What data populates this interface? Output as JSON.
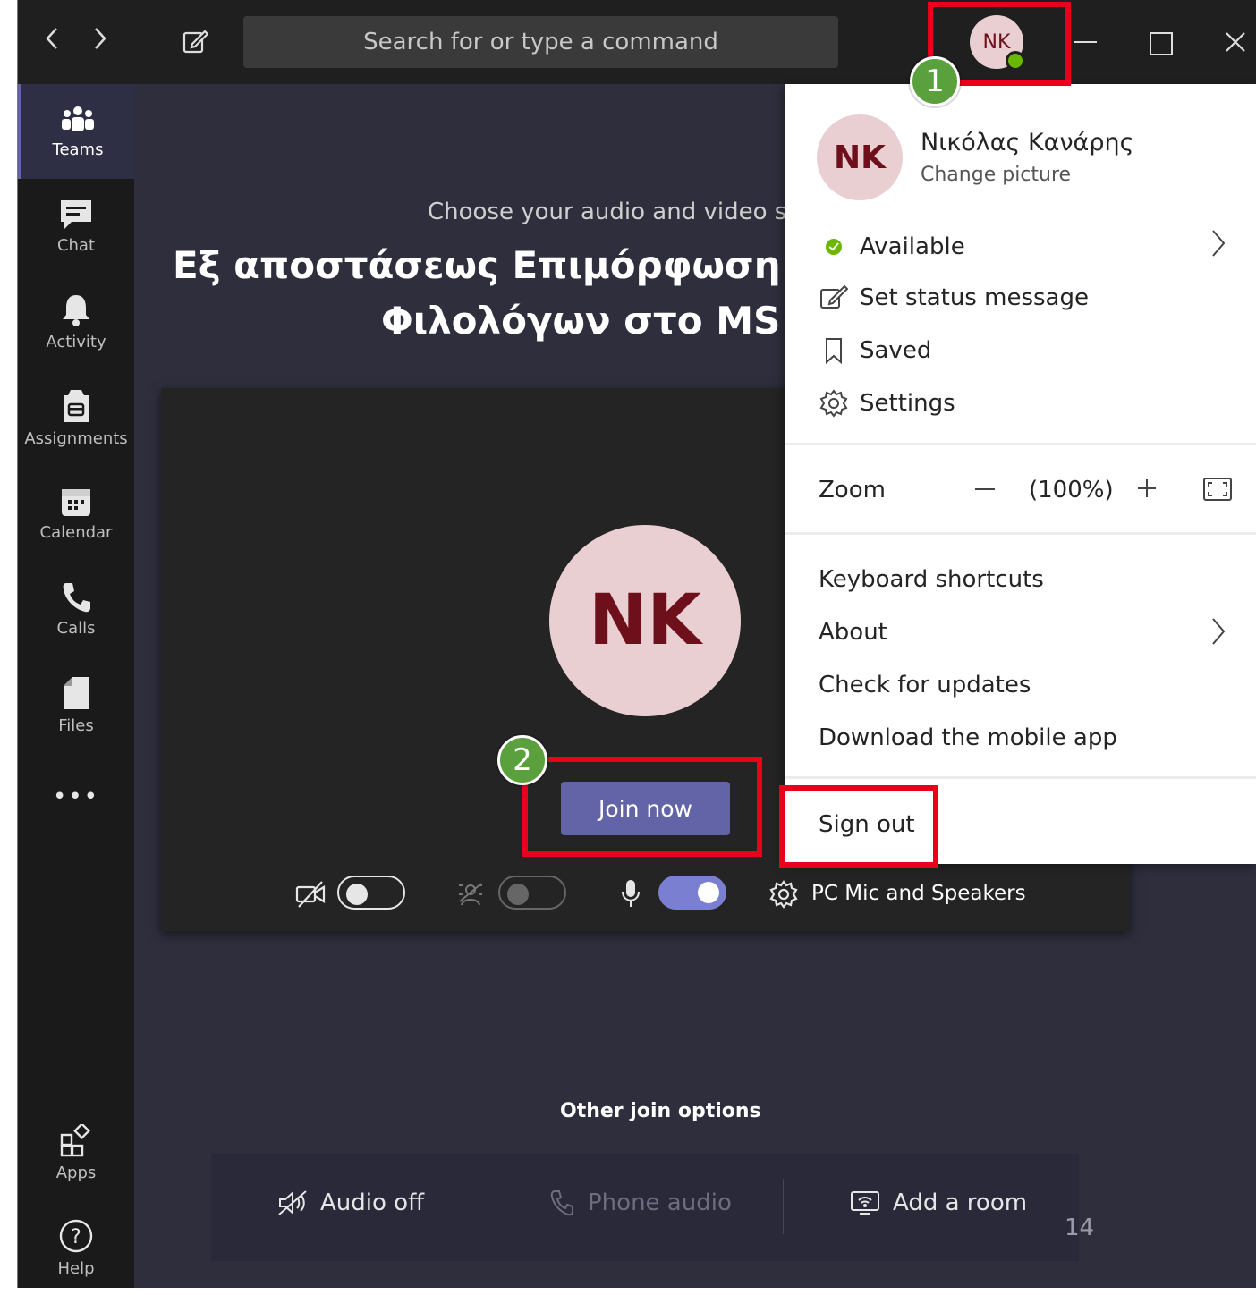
{
  "titlebar": {
    "search_placeholder": "Search for or type a command",
    "avatar_initials": "NK"
  },
  "rail": {
    "items": [
      {
        "label": "Teams",
        "icon": "teams-icon"
      },
      {
        "label": "Chat",
        "icon": "chat-icon"
      },
      {
        "label": "Activity",
        "icon": "bell-icon"
      },
      {
        "label": "Assignments",
        "icon": "assignments-icon"
      },
      {
        "label": "Calendar",
        "icon": "calendar-icon"
      },
      {
        "label": "Calls",
        "icon": "phone-icon"
      },
      {
        "label": "Files",
        "icon": "file-icon"
      }
    ],
    "more": "•••",
    "bottom": [
      {
        "label": "Apps",
        "icon": "apps-icon"
      },
      {
        "label": "Help",
        "icon": "help-icon"
      }
    ]
  },
  "prejoin": {
    "choose_text": "Choose your audio and video sett",
    "title_line1": "Εξ αποστάσεως Επιμόρφωση Κα",
    "title_line2": "Φιλολόγων στο MS T",
    "avatar_initials": "NK",
    "join_button": "Join now",
    "device_label": "PC Mic and Speakers",
    "video_on": false,
    "blur_on": false,
    "mic_on": true
  },
  "other_join": {
    "heading": "Other join options",
    "options": [
      {
        "label": "Audio off",
        "icon": "speaker-off-icon",
        "enabled": true
      },
      {
        "label": "Phone audio",
        "icon": "phone-icon",
        "enabled": false
      },
      {
        "label": "Add a room",
        "icon": "room-icon",
        "enabled": true
      }
    ]
  },
  "profile_menu": {
    "initials": "NK",
    "user_name": "Νικόλας Κανάρης",
    "change_picture": "Change picture",
    "status": "Available",
    "set_status": "Set status message",
    "saved": "Saved",
    "settings": "Settings",
    "zoom_label": "Zoom",
    "zoom_value": "(100%)",
    "keyboard_shortcuts": "Keyboard shortcuts",
    "about": "About",
    "check_updates": "Check for updates",
    "download_mobile": "Download the mobile app",
    "sign_out": "Sign out"
  },
  "annotations": {
    "badge1": "1",
    "badge2": "2",
    "page_number": "14"
  },
  "colors": {
    "accent": "#6264a7",
    "highlight": "#e8001c",
    "badge": "#5aa13e",
    "presence": "#6bb700"
  }
}
